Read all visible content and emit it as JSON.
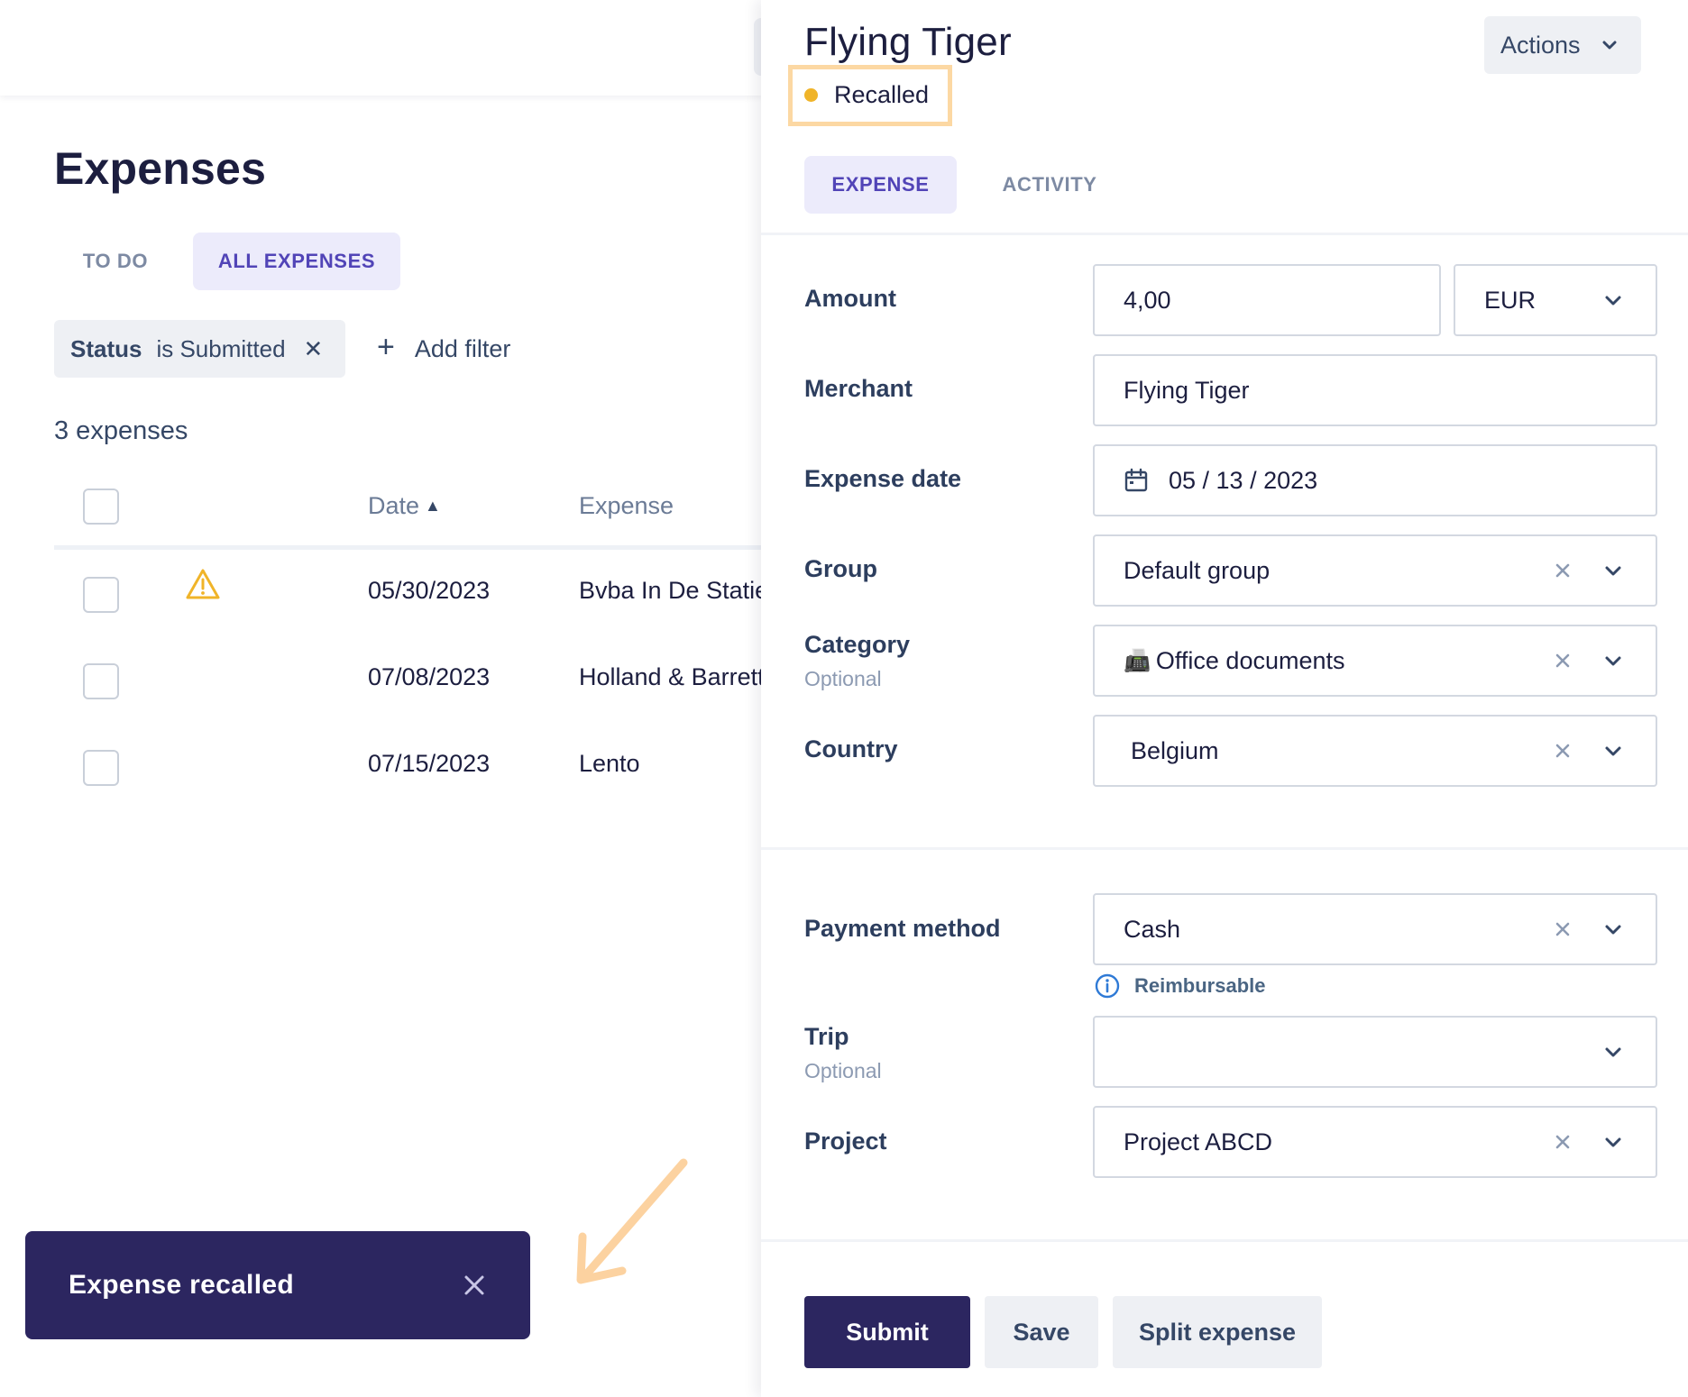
{
  "list": {
    "title": "Expenses",
    "tabs": [
      {
        "label": "TO DO"
      },
      {
        "label": "ALL EXPENSES"
      }
    ],
    "filter": {
      "key": "Status",
      "value": "is Submitted",
      "remove_glyph": "✕"
    },
    "add_filter": {
      "plus": "+",
      "label": "Add filter"
    },
    "count": "3 expenses",
    "columns": {
      "date": "Date",
      "date_sort_glyph": "▲",
      "expense": "Expense"
    },
    "rows": [
      {
        "date": "05/30/2023",
        "expense": "Bvba In De Statie",
        "warning": true
      },
      {
        "date": "07/08/2023",
        "expense": "Holland & Barrett",
        "warning": false
      },
      {
        "date": "07/15/2023",
        "expense": "Lento",
        "warning": false
      }
    ]
  },
  "toast": {
    "message": "Expense recalled"
  },
  "drawer": {
    "title": "Flying Tiger",
    "status": "Recalled",
    "actions_label": "Actions",
    "tabs": [
      {
        "label": "EXPENSE"
      },
      {
        "label": "ACTIVITY"
      }
    ],
    "fields": {
      "amount": {
        "label": "Amount",
        "value": "4,00",
        "currency": "EUR"
      },
      "merchant": {
        "label": "Merchant",
        "value": "Flying Tiger"
      },
      "expense_date": {
        "label": "Expense date",
        "value": "05 / 13 / 2023"
      },
      "group": {
        "label": "Group",
        "value": "Default group"
      },
      "category": {
        "label": "Category",
        "optional": "Optional",
        "emoji": "📠",
        "value": "Office documents"
      },
      "country": {
        "label": "Country",
        "value": "Belgium"
      },
      "payment_method": {
        "label": "Payment method",
        "value": "Cash",
        "note": "Reimbursable"
      },
      "trip": {
        "label": "Trip",
        "optional": "Optional",
        "value": ""
      },
      "project": {
        "label": "Project",
        "value": "Project ABCD"
      }
    },
    "buttons": {
      "submit": "Submit",
      "save": "Save",
      "split": "Split expense"
    }
  },
  "colors": {
    "primary_dark": "#2c2660",
    "accent_purple": "#5144b7",
    "status_dot": "#f0b429",
    "highlight_box": "#fcd8a3",
    "arrow": "#fcd2a0"
  },
  "icons": [
    "warning-icon",
    "calendar-icon",
    "info-icon",
    "chevron-down-icon",
    "clear-icon",
    "close-icon",
    "arrow-pointer-icon"
  ]
}
